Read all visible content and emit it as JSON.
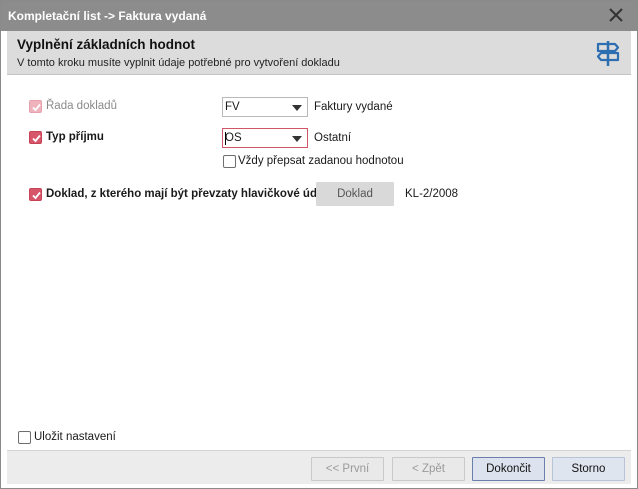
{
  "window": {
    "title": "Kompletační list -> Faktura vydaná"
  },
  "step": {
    "title": "Vyplnění základních hodnot",
    "subtitle": "V tomto kroku musíte vyplnit údaje potřebné pro vytvoření dokladu",
    "icon": "signpost-icon"
  },
  "form": {
    "rada": {
      "label": "Řada dokladů",
      "checked": true,
      "disabled": true,
      "value": "FV",
      "description": "Faktury vydané"
    },
    "typ": {
      "label": "Typ příjmu",
      "checked": true,
      "value": "OS",
      "description": "Ostatní",
      "overwrite_label": "Vždy přepsat zadanou hodnotou",
      "overwrite_checked": false
    },
    "doklad": {
      "label": "Doklad, z kterého mají být převzaty hlavičkové údaje",
      "checked": true,
      "button_label": "Doklad",
      "value": "KL-2/2008"
    }
  },
  "footer": {
    "save_settings_label": "Uložit nastavení",
    "save_settings_checked": false,
    "buttons": {
      "first": "<< První",
      "back": "< Zpět",
      "finish": "Dokončit",
      "cancel": "Storno"
    }
  },
  "colors": {
    "accent": "#d8566a",
    "titlebar": "#8c8c8c",
    "header": "#dcdcdc",
    "sign_icon": "#2d6fb0"
  }
}
